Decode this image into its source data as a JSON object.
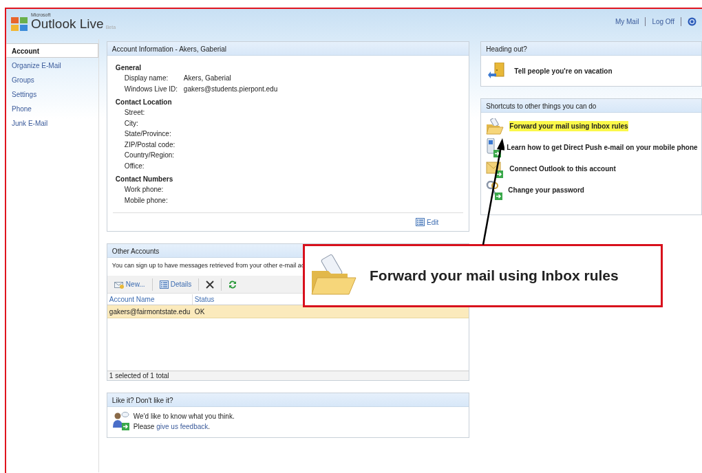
{
  "header": {
    "logo_small": "Microsoft",
    "logo": "Outlook Live",
    "logo_tag": "Beta",
    "links": [
      "My Mail",
      "Log Off"
    ]
  },
  "sidebar": {
    "items": [
      {
        "label": "Account",
        "selected": true
      },
      {
        "label": "Organize E-Mail",
        "selected": false
      },
      {
        "label": "Groups",
        "selected": false
      },
      {
        "label": "Settings",
        "selected": false
      },
      {
        "label": "Phone",
        "selected": false
      },
      {
        "label": "Junk E-Mail",
        "selected": false
      }
    ]
  },
  "account_info": {
    "title": "Account Information - Akers, Gaberial",
    "sections": [
      {
        "heading": "General",
        "fields": [
          {
            "label": "Display name:",
            "value": "Akers, Gaberial"
          },
          {
            "label": "Windows Live ID:",
            "value": "gakers@students.pierpont.edu"
          }
        ]
      },
      {
        "heading": "Contact Location",
        "fields": [
          {
            "label": "Street:"
          },
          {
            "label": "City:"
          },
          {
            "label": "State/Province:"
          },
          {
            "label": "ZIP/Postal code:"
          },
          {
            "label": "Country/Region:"
          },
          {
            "label": "Office:"
          }
        ]
      },
      {
        "heading": "Contact Numbers",
        "fields": [
          {
            "label": "Work phone:"
          },
          {
            "label": "Mobile phone:"
          }
        ]
      }
    ],
    "edit": "Edit"
  },
  "other_accounts": {
    "title": "Other Accounts",
    "description": "You can sign up to have messages retrieved from your other e-mail ac",
    "toolbar": [
      {
        "kind": "new",
        "label": "New..."
      },
      {
        "kind": "details",
        "label": "Details"
      },
      {
        "kind": "delete"
      },
      {
        "kind": "refresh"
      }
    ],
    "table": {
      "columns": [
        "Account Name",
        "Status"
      ],
      "rows": [
        {
          "cells": [
            "gakers@fairmontstate.edu",
            "OK"
          ],
          "selected": true
        }
      ]
    },
    "footer": "1 selected of 1 total"
  },
  "feedback": {
    "title": "Like it? Don't like it?",
    "line1": "We'd like to know what you think.",
    "line2_prefix": "Please",
    "link": "give us feedback",
    "line2_suffix": "."
  },
  "heading_out": {
    "title": "Heading out?",
    "action": "Tell people you're on vacation"
  },
  "shortcuts": {
    "title": "Shortcuts to other things you can do",
    "items": [
      {
        "kind": "folder",
        "label": "Forward your mail using Inbox rules",
        "highlighted": true
      },
      {
        "kind": "phone",
        "label": "Learn how to get Direct Push e-mail on your mobile phone",
        "highlighted": false
      },
      {
        "kind": "outlook",
        "label": "Connect Outlook to this account",
        "highlighted": false
      },
      {
        "kind": "keys",
        "label": "Change your password",
        "highlighted": false
      }
    ]
  },
  "callout": {
    "label": "Forward your mail using Inbox rules"
  }
}
